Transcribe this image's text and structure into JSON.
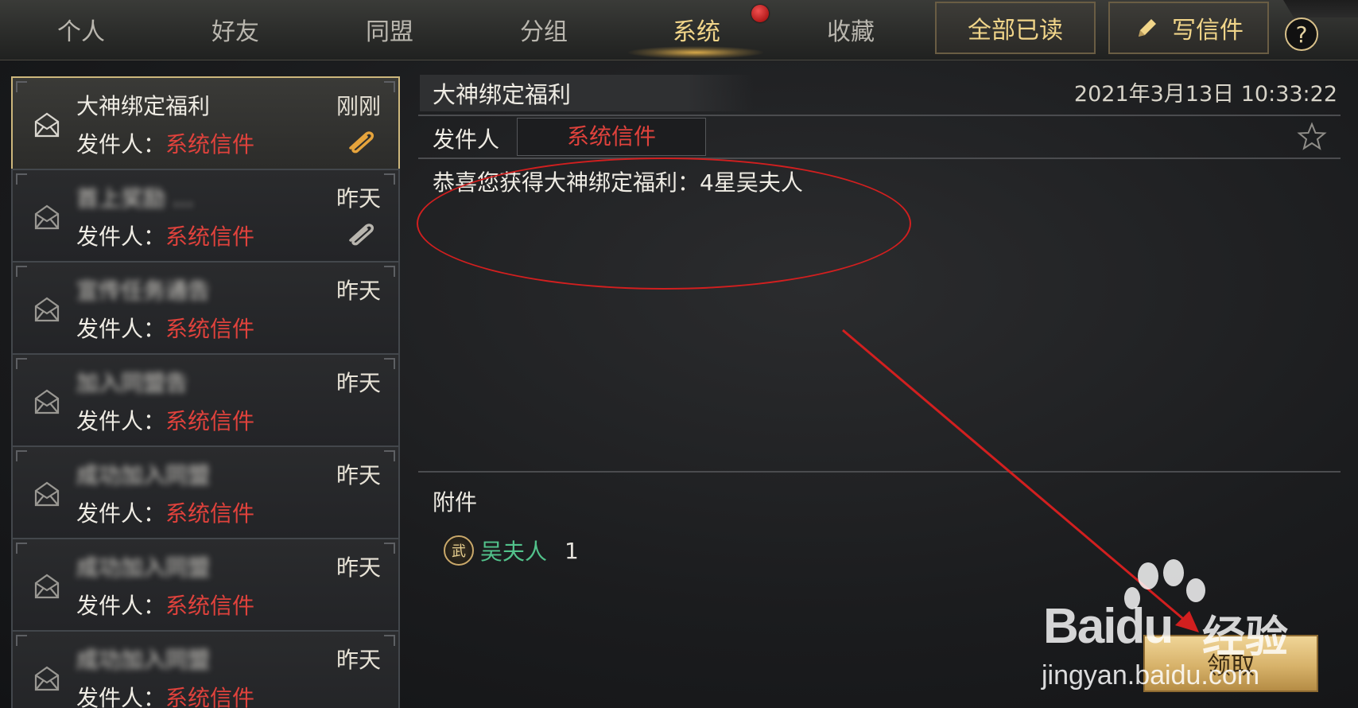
{
  "tabs": [
    {
      "label": "个人",
      "active": false
    },
    {
      "label": "好友",
      "active": false
    },
    {
      "label": "同盟",
      "active": false
    },
    {
      "label": "分组",
      "active": false
    },
    {
      "label": "系统",
      "active": true
    },
    {
      "label": "收藏",
      "active": false
    }
  ],
  "toolbar": {
    "mark_all_read": "全部已读",
    "write_mail": "写信件",
    "help": "?"
  },
  "mail_list": [
    {
      "title": "大神绑定福利",
      "time": "刚刚",
      "sender_label": "发件人：",
      "sender": "系统信件",
      "has_attachment": true,
      "attachment_claimed": false,
      "selected": true
    },
    {
      "title": "首上奖励 ...",
      "time": "昨天",
      "sender_label": "发件人：",
      "sender": "系统信件",
      "has_attachment": true,
      "attachment_claimed": true,
      "selected": false
    },
    {
      "title": "宣传任务通告",
      "time": "昨天",
      "sender_label": "发件人：",
      "sender": "系统信件",
      "has_attachment": false,
      "selected": false
    },
    {
      "title": "加入同盟告",
      "time": "昨天",
      "sender_label": "发件人：",
      "sender": "系统信件",
      "has_attachment": false,
      "selected": false
    },
    {
      "title": "成功加入同盟",
      "time": "昨天",
      "sender_label": "发件人：",
      "sender": "系统信件",
      "has_attachment": false,
      "selected": false
    },
    {
      "title": "成功加入同盟",
      "time": "昨天",
      "sender_label": "发件人：",
      "sender": "系统信件",
      "has_attachment": false,
      "selected": false
    },
    {
      "title": "成功加入同盟",
      "time": "昨天",
      "sender_label": "发件人：",
      "sender": "系统信件",
      "has_attachment": false,
      "selected": false
    }
  ],
  "detail": {
    "title": "大神绑定福利",
    "date": "2021年3月13日 10:33:22",
    "sender_label": "发件人",
    "sender": "系统信件",
    "content": "恭喜您获得大神绑定福利：4星吴夫人",
    "attachment_label": "附件",
    "attachment_badge": "武",
    "attachment_name": "吴夫人",
    "attachment_qty": "1",
    "claim_button": "领取"
  },
  "watermark": {
    "logo_text": "Bai",
    "logo_text_2": "du",
    "cn": "经验",
    "url": "jingyan.baidu.com"
  },
  "colors": {
    "accent_gold": "#f1d589",
    "sender_red": "#e0423c",
    "attachment_green": "#52c28b",
    "annotation_red": "#d21f1f"
  }
}
